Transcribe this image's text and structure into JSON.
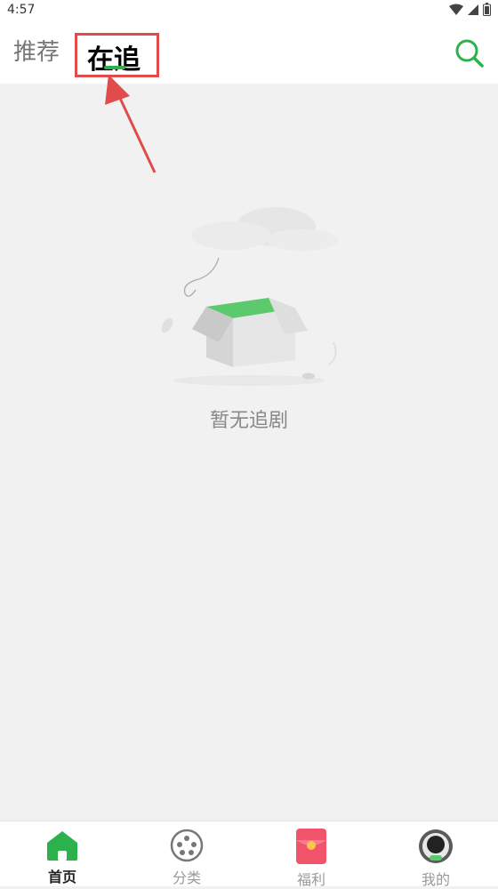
{
  "status_bar": {
    "time": "4:57"
  },
  "header": {
    "tabs": [
      {
        "label": "推荐",
        "active": false
      },
      {
        "label": "在追",
        "active": true
      }
    ]
  },
  "empty_state": {
    "message": "暂无追剧"
  },
  "bottom_nav": {
    "items": [
      {
        "label": "首页",
        "icon": "home-icon",
        "active": true
      },
      {
        "label": "分类",
        "icon": "category-icon",
        "active": false
      },
      {
        "label": "福利",
        "icon": "red-envelope-icon",
        "active": false
      },
      {
        "label": "我的",
        "icon": "profile-icon",
        "active": false
      }
    ]
  },
  "colors": {
    "accent": "#2bb24c",
    "annotation": "#e24b4b"
  }
}
